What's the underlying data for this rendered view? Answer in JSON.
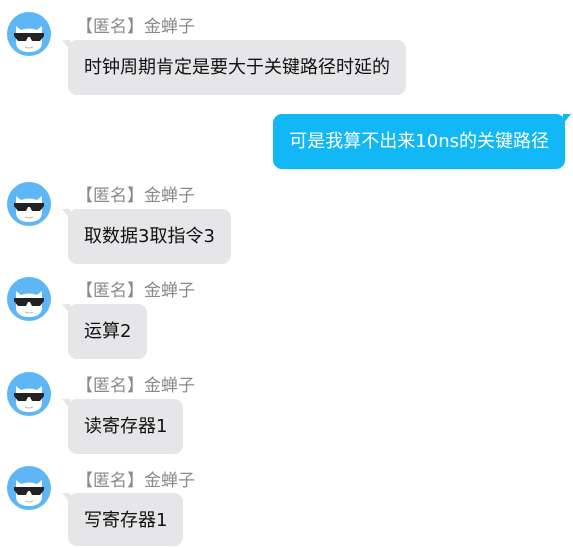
{
  "colors": {
    "incoming_bubble": "#e6e6e9",
    "outgoing_bubble": "#12b7f5",
    "sender_text": "#8a8a8a",
    "avatar_bg": "#5eb6f5"
  },
  "messages": [
    {
      "direction": "incoming",
      "sender": "【匿名】金蝉子",
      "text": "时钟周期肯定是要大于关键路径时延的",
      "avatar": "cat-sunglasses-avatar"
    },
    {
      "direction": "outgoing",
      "text": "可是我算不出来10ns的关键路径"
    },
    {
      "direction": "incoming",
      "sender": "【匿名】金蝉子",
      "text": "取数据3取指令3",
      "avatar": "cat-sunglasses-avatar"
    },
    {
      "direction": "incoming",
      "sender": "【匿名】金蝉子",
      "text": "运算2",
      "avatar": "cat-sunglasses-avatar"
    },
    {
      "direction": "incoming",
      "sender": "【匿名】金蝉子",
      "text": "读寄存器1",
      "avatar": "cat-sunglasses-avatar"
    },
    {
      "direction": "incoming",
      "sender": "【匿名】金蝉子",
      "text": "写寄存器1",
      "avatar": "cat-sunglasses-avatar"
    }
  ]
}
